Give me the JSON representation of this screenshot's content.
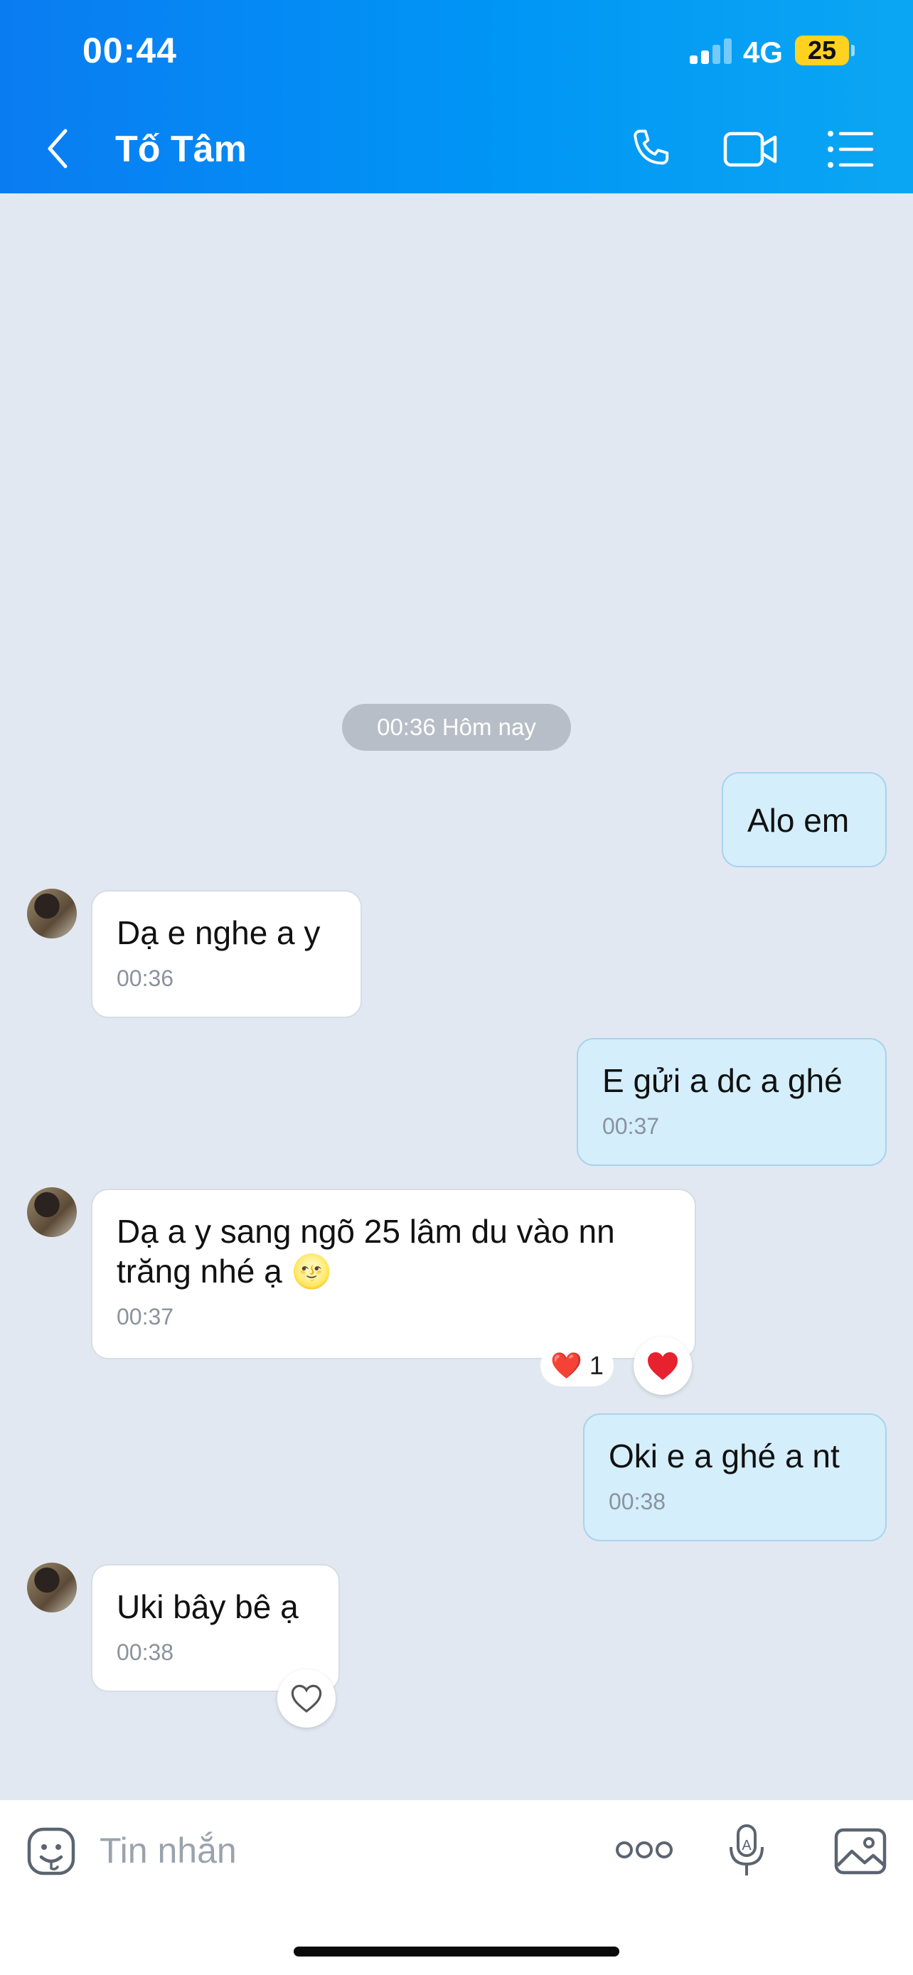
{
  "status_bar": {
    "time": "00:44",
    "network": "4G",
    "battery": "25"
  },
  "header": {
    "contact_name": "Tố Tâm"
  },
  "chat": {
    "date_separator": "00:36 Hôm nay",
    "messages": [
      {
        "dir": "out",
        "text": "Alo em",
        "time": ""
      },
      {
        "dir": "in",
        "text": "Dạ e nghe a y",
        "time": "00:36"
      },
      {
        "dir": "out",
        "text": "E gửi a dc a ghé",
        "time": "00:37"
      },
      {
        "dir": "in",
        "text": "Dạ a y sang ngõ 25 lâm du vào nn trăng nhé ạ 🌝",
        "time": "00:37",
        "reaction": {
          "emoji": "❤️",
          "count": "1"
        }
      },
      {
        "dir": "out",
        "text": "Oki e a ghé a nt",
        "time": "00:38"
      },
      {
        "dir": "in",
        "text": "Uki bây bê ạ",
        "time": "00:38"
      }
    ]
  },
  "composer": {
    "placeholder": "Tin nhắn"
  },
  "colors": {
    "header_gradient_start": "#0a7cf2",
    "header_gradient_end": "#0ba6f3",
    "chat_background": "#e2e8f1",
    "outgoing_bubble": "#d4eefc",
    "incoming_bubble": "#ffffff",
    "heart": "#e8212f"
  },
  "icons": [
    "back-chevron-icon",
    "phone-icon",
    "video-call-icon",
    "menu-list-icon",
    "sticker-icon",
    "more-options-icon",
    "voice-to-text-icon",
    "image-icon",
    "heart-icon",
    "heart-outline-icon"
  ]
}
